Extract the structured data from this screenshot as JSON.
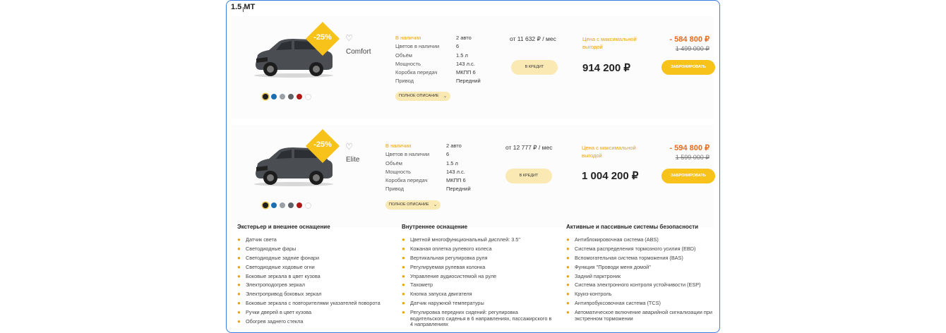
{
  "section": {
    "title": "1.5 МТ"
  },
  "swatches": [
    "#1f1f1f",
    "#1b6fb0",
    "#9aa0a6",
    "#5e6368",
    "#b01818",
    "#ffffff"
  ],
  "labels": {
    "in_stock": "В наличии",
    "colors": "Цветов в наличии",
    "volume": "Объём",
    "power": "Мощность",
    "gearbox": "Коробка передач",
    "drive": "Привод",
    "full_desc": "ПОЛНОЕ ОПИСАНИЕ",
    "credit": "В КРЕДИТ",
    "max_benefit": "Цена с максимальной выгодой",
    "book": "ЗАБРОНИРОВАТЬ"
  },
  "cards": [
    {
      "trim": "Comfort",
      "badge": "-25%",
      "in_stock": "2 авто",
      "colors": "6",
      "volume": "1.5 л",
      "power": "143 л.с.",
      "gearbox": "МКПП 6",
      "drive": "Передний",
      "monthly": "от 11 632 ₽ / мес",
      "price": "914 200 ₽",
      "discount": "- 584 800 ₽",
      "old_price": "1 499 000 ₽"
    },
    {
      "trim": "Elite",
      "badge": "-25%",
      "in_stock": "2 авто",
      "colors": "6",
      "volume": "1.5 л",
      "power": "143 л.с.",
      "gearbox": "МКПП 6",
      "drive": "Передний",
      "monthly": "от 12 777 ₽ / мес",
      "price": "1 004 200 ₽",
      "discount": "- 594 800 ₽",
      "old_price": "1 599 000 ₽"
    }
  ],
  "features": [
    {
      "title": "Экстерьер и внешнее оснащение",
      "items": [
        "Датчик света",
        "Светодиодные фары",
        "Светодиодные задние фонари",
        "Светодиодные ходовые огни",
        "Боковые зеркала в цвет кузова",
        "Электроподогрев зеркал",
        "Электропривод боковых зеркал",
        "Боковые зеркала с повторителями указателей поворота",
        "Ручки дверей в цвет кузова",
        "Обогрев заднего стекла"
      ]
    },
    {
      "title": "Внутреннее оснащение",
      "items": [
        "Цветной многофункциональный дисплей: 3.5\"",
        "Кожаная оплетка рулевого колеса",
        "Вертикальная регулировка руля",
        "Регулируемая рулевая колонка",
        "Управление аудиосистемой на руле",
        "Тахометр",
        "Кнопка запуска двигателя",
        "Датчик наружной температуры",
        "Регулировка передних сидений: регулировка водительского сиденья в 6 направлениях, пассажирского в 4 направлениях"
      ]
    },
    {
      "title": "Активные и пассивные системы безопасности",
      "items": [
        "Антиблокировочная система (ABS)",
        "Система распределения тормозного усилия (EBD)",
        "Вспомогательная система торможения (BAS)",
        "Функция \"Проводи меня домой\"",
        "Задний парктроник",
        "Система электронного контроля устойчивости (ESP)",
        "Круиз-контроль",
        "Антипробуксовочная система (TCS)",
        "Автоматическое включение аварийной сигнализации при экстренном торможении"
      ]
    }
  ]
}
